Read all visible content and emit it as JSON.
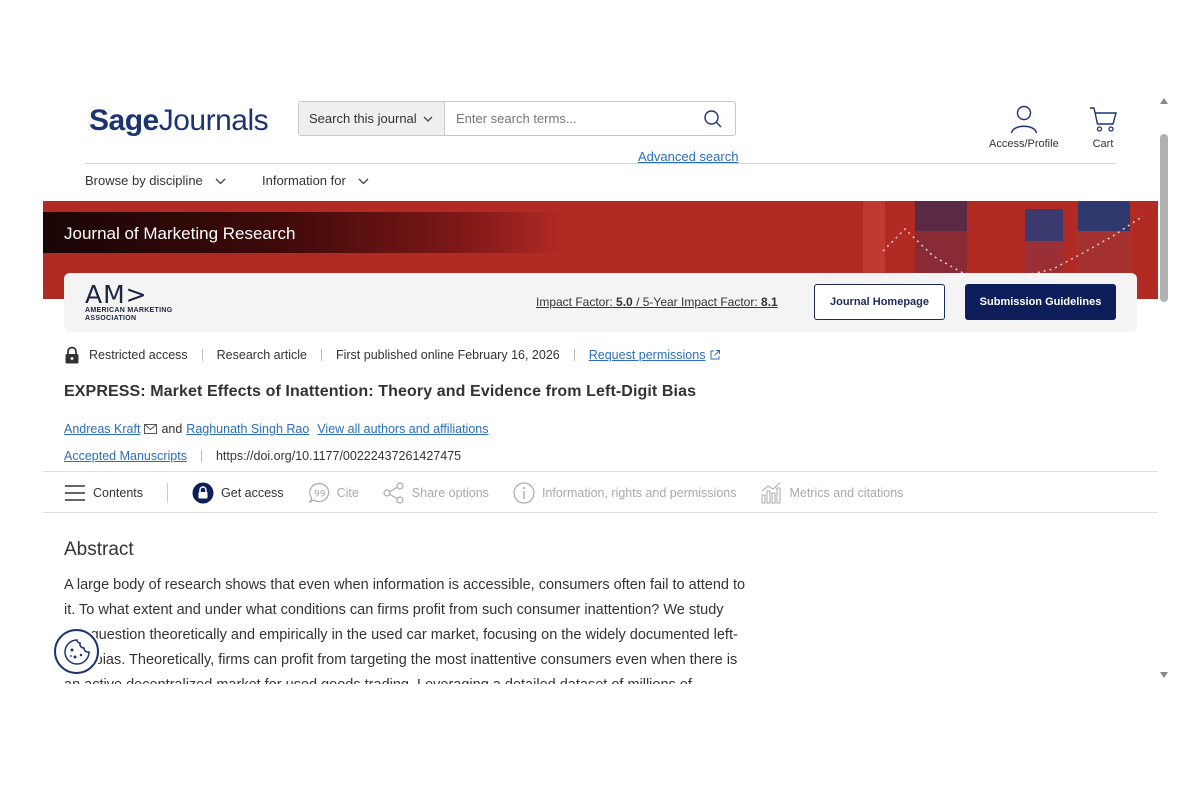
{
  "header": {
    "logo_part1": "Sage",
    "logo_part2": "Journals",
    "search_scope": "Search this journal",
    "search_placeholder": "Enter search terms...",
    "advanced_search": "Advanced search",
    "profile_label": "Access/Profile",
    "cart_label": "Cart"
  },
  "nav": {
    "browse": "Browse by discipline",
    "info_for": "Information for"
  },
  "banner": {
    "journal_title": "Journal of Marketing Research"
  },
  "journal_card": {
    "publisher_mark": "AM>",
    "publisher_line1": "AMERICAN MARKETING",
    "publisher_line2": "ASSOCIATION",
    "impact_label": "Impact Factor:",
    "impact_value": "5.0",
    "impact_sep": "/",
    "five_year_label": "5-Year Impact Factor:",
    "five_year_value": "8.1",
    "homepage_button": "Journal Homepage",
    "submission_button": "Submission Guidelines"
  },
  "article": {
    "access": "Restricted access",
    "type": "Research article",
    "published": "First published online February 16, 2026",
    "permissions": "Request permissions",
    "title": "EXPRESS: Market Effects of Inattention: Theory and Evidence from Left-Digit Bias",
    "author1": "Andreas Kraft",
    "and_text": "and",
    "author2": "Raghunath Singh Rao",
    "all_authors": "View all authors and affiliations",
    "manuscripts": "Accepted Manuscripts",
    "doi": "https://doi.org/10.1177/00222437261427475"
  },
  "toolbar": {
    "contents": "Contents",
    "get_access": "Get access",
    "cite": "Cite",
    "share": "Share options",
    "info": "Information, rights and permissions",
    "metrics": "Metrics and citations"
  },
  "abstract": {
    "heading": "Abstract",
    "line1": "A large body of research shows that even when information is accessible, consumers often fail to attend to",
    "line2": "it. To what extent and under what conditions can firms profit from such consumer inattention? We study",
    "line3": "this question theoretically and empirically in the used car market, focusing on the widely documented left-",
    "line4": "digit bias. Theoretically, firms can profit from targeting the most inattentive consumers even when there is",
    "line5": "an active decentralized market for used goods trading. Leveraging a detailed dataset of millions of"
  },
  "colors": {
    "brand_navy": "#1c3471",
    "banner_red": "#b22a24",
    "link_blue": "#2a6ebb",
    "button_navy": "#0e1e5b"
  }
}
